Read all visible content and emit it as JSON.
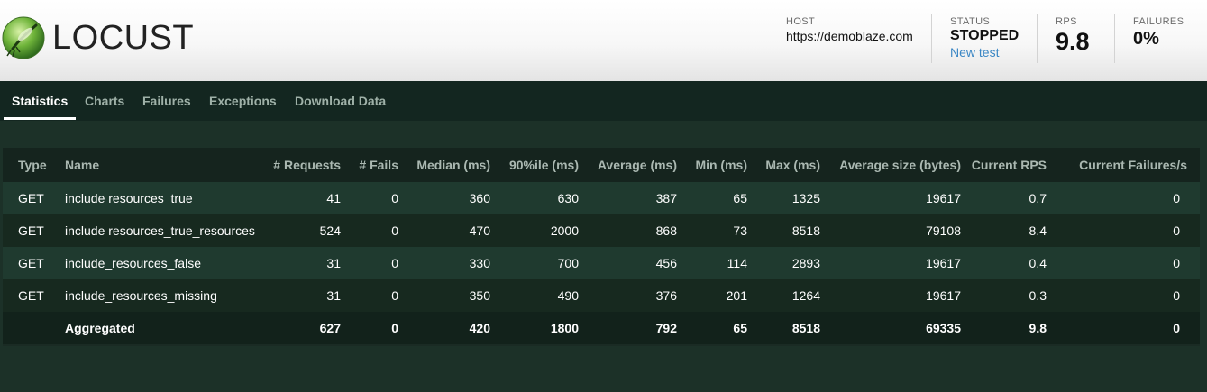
{
  "brand": {
    "name": "LOCUST"
  },
  "header": {
    "host": {
      "label": "HOST",
      "value": "https://demoblaze.com"
    },
    "status": {
      "label": "STATUS",
      "value": "STOPPED",
      "action": "New test"
    },
    "rps": {
      "label": "RPS",
      "value": "9.8"
    },
    "failures": {
      "label": "FAILURES",
      "value": "0%"
    }
  },
  "tabs": [
    {
      "label": "Statistics",
      "active": true
    },
    {
      "label": "Charts"
    },
    {
      "label": "Failures"
    },
    {
      "label": "Exceptions"
    },
    {
      "label": "Download Data"
    }
  ],
  "table": {
    "columns": [
      "Type",
      "Name",
      "# Requests",
      "# Fails",
      "Median (ms)",
      "90%ile (ms)",
      "Average (ms)",
      "Min (ms)",
      "Max (ms)",
      "Average size (bytes)",
      "Current RPS",
      "Current Failures/s"
    ],
    "rows": [
      [
        "GET",
        "include resources_true",
        "41",
        "0",
        "360",
        "630",
        "387",
        "65",
        "1325",
        "19617",
        "0.7",
        "0"
      ],
      [
        "GET",
        "include resources_true_resources",
        "524",
        "0",
        "470",
        "2000",
        "868",
        "73",
        "8518",
        "79108",
        "8.4",
        "0"
      ],
      [
        "GET",
        "include_resources_false",
        "31",
        "0",
        "330",
        "700",
        "456",
        "114",
        "2893",
        "19617",
        "0.4",
        "0"
      ],
      [
        "GET",
        "include_resources_missing",
        "31",
        "0",
        "350",
        "490",
        "376",
        "201",
        "1264",
        "19617",
        "0.3",
        "0"
      ]
    ],
    "aggregated": [
      "",
      "Aggregated",
      "627",
      "0",
      "420",
      "1800",
      "792",
      "65",
      "8518",
      "69335",
      "9.8",
      "0"
    ]
  },
  "colors": {
    "accent_link": "#3a86c4",
    "background": "#1c3128",
    "nav": "#132620"
  }
}
